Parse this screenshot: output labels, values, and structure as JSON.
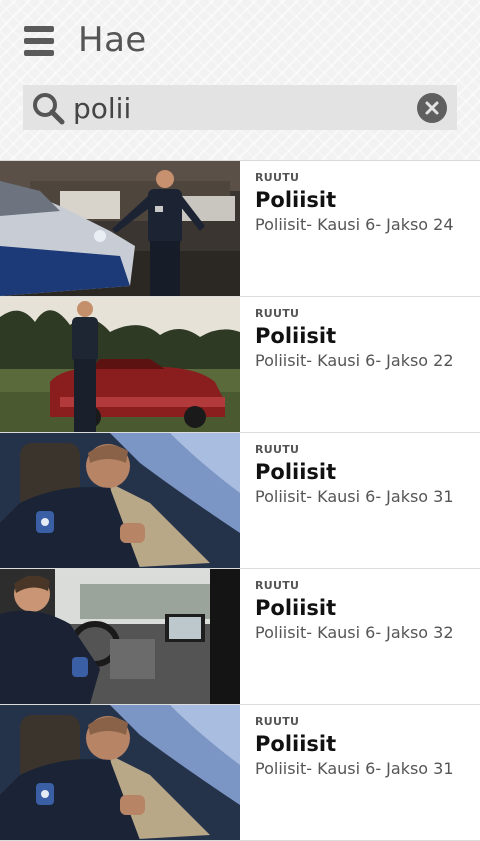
{
  "header": {
    "title": "Hae",
    "search": {
      "value": "polii"
    }
  },
  "results": [
    {
      "channel": "RUUTU",
      "title": "Poliisit",
      "episode": "Poliisit- Kausi 6- Jakso 24"
    },
    {
      "channel": "RUUTU",
      "title": "Poliisit",
      "episode": "Poliisit- Kausi 6- Jakso 22"
    },
    {
      "channel": "RUUTU",
      "title": "Poliisit",
      "episode": "Poliisit- Kausi 6- Jakso 31"
    },
    {
      "channel": "RUUTU",
      "title": "Poliisit",
      "episode": "Poliisit- Kausi 6- Jakso 32"
    },
    {
      "channel": "RUUTU",
      "title": "Poliisit",
      "episode": "Poliisit- Kausi 6- Jakso 31"
    }
  ]
}
